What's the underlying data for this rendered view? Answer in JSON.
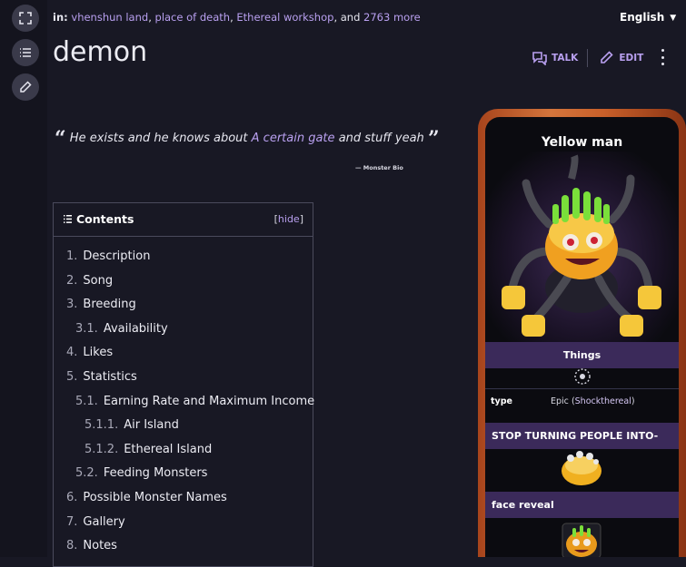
{
  "rail": {
    "fullscreen_icon": "expand-icon",
    "toc_icon": "list-icon",
    "edit_icon": "pencil-icon"
  },
  "breadcrumb": {
    "prefix": "in:",
    "categories": [
      "vhenshun land",
      "place of death",
      "Ethereal workshop"
    ],
    "sep1": ",",
    "sep2": ",",
    "sep3": ", and",
    "more": "2763 more"
  },
  "language": {
    "label": "English"
  },
  "page": {
    "title": "demon"
  },
  "actions": {
    "talk": "TALK",
    "edit": "EDIT"
  },
  "quote": {
    "open": "“",
    "close": "”",
    "before": "He exists and he knows about",
    "link": "A certain gate",
    "after": "and stuff yeah",
    "source": "— Monster Bio"
  },
  "toc": {
    "title": "Contents",
    "hide_open": "[",
    "hide": "hide",
    "hide_close": "]",
    "items": [
      {
        "num": "1.",
        "label": "Description",
        "level": 1
      },
      {
        "num": "2.",
        "label": "Song",
        "level": 1
      },
      {
        "num": "3.",
        "label": "Breeding",
        "level": 1
      },
      {
        "num": "3.1.",
        "label": "Availability",
        "level": 2
      },
      {
        "num": "4.",
        "label": "Likes",
        "level": 1
      },
      {
        "num": "5.",
        "label": "Statistics",
        "level": 1
      },
      {
        "num": "5.1.",
        "label": "Earning Rate and Maximum Income",
        "level": 2
      },
      {
        "num": "5.1.1.",
        "label": "Air Island",
        "level": 3
      },
      {
        "num": "5.1.2.",
        "label": "Ethereal Island",
        "level": 3
      },
      {
        "num": "5.2.",
        "label": "Feeding Monsters",
        "level": 2
      },
      {
        "num": "6.",
        "label": "Possible Monster Names",
        "level": 1
      },
      {
        "num": "7.",
        "label": "Gallery",
        "level": 1
      },
      {
        "num": "8.",
        "label": "Notes",
        "level": 1
      }
    ]
  },
  "infobox": {
    "name": "Yellow man",
    "section1": "Things",
    "type_key": "type",
    "type_value": "Epic",
    "type_open": "(",
    "type_link": "Shockthereal",
    "type_close": ")",
    "section2": "STOP TURNING PEOPLE INTO-",
    "section3": "face reveal",
    "colors": {
      "frame": "#c9602a",
      "band": "#3b2a5a",
      "accent": "#b9a0f0"
    }
  }
}
